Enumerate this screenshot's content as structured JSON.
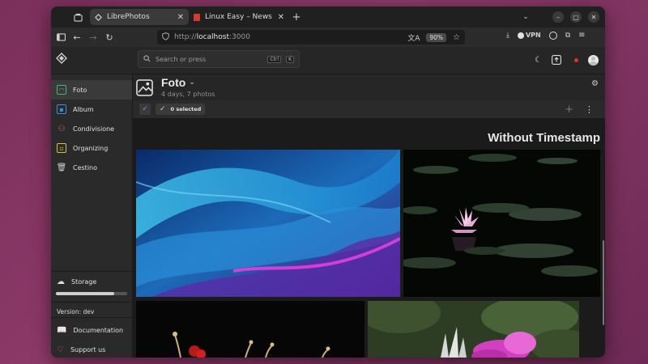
{
  "browser": {
    "tabs": [
      {
        "title": "LibrePhotos",
        "active": true
      },
      {
        "title": "Linux Easy – News da Mo",
        "active": false
      }
    ],
    "url_prefix": "http://",
    "url_host": "localhost",
    "url_port": ":3000",
    "zoom": "90%",
    "vpn_label": "VPN"
  },
  "app": {
    "search_placeholder": "Search or press",
    "search_kbd1": "Ctrl",
    "search_kbd2": "K"
  },
  "sidebar": {
    "items": [
      {
        "label": "Foto",
        "icon": "photo-icon",
        "color": "#3fb87a"
      },
      {
        "label": "Album",
        "icon": "album-icon",
        "color": "#3b8fd9"
      },
      {
        "label": "Condivisione",
        "icon": "users-icon",
        "color": "#e0605f"
      },
      {
        "label": "Organizing",
        "icon": "organize-icon",
        "color": "#d6c03a"
      },
      {
        "label": "Cestino",
        "icon": "trash-icon",
        "color": "#cfcfcf"
      }
    ],
    "storage_label": "Storage",
    "storage_used_fraction": 0.82,
    "version": "Version: dev",
    "documentation": "Documentation",
    "support": "Support us"
  },
  "main": {
    "title": "Foto",
    "subtitle": "4 days, 7 photos",
    "selected_label": "0 selected",
    "section_title": "Without Timestamp"
  }
}
